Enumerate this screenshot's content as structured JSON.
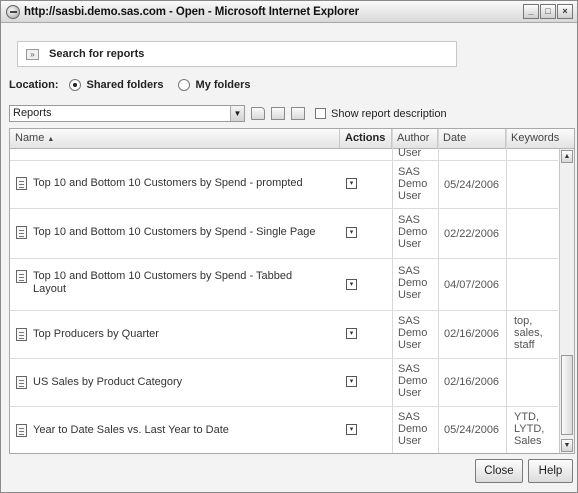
{
  "window": {
    "title": "http://sasbi.demo.sas.com - Open - Microsoft Internet Explorer",
    "controls": [
      "_",
      "□",
      "×"
    ]
  },
  "search": {
    "label": "Search for reports"
  },
  "location": {
    "label": "Location:",
    "options": [
      {
        "label": "Shared folders",
        "selected": true
      },
      {
        "label": "My folders",
        "selected": false
      }
    ]
  },
  "toolbar": {
    "folder_value": "Reports",
    "show_description_label": "Show report description",
    "show_description_checked": false
  },
  "grid": {
    "columns": [
      "Name",
      "Actions",
      "Author",
      "Date",
      "Keywords"
    ],
    "sort_indicator": "▲",
    "partial_top_author": "User",
    "rows": [
      {
        "name": "Top 10 and Bottom 10 Customers by Spend - prompted",
        "author": [
          "SAS",
          "Demo",
          "User"
        ],
        "date": "05/24/2006",
        "keywords": []
      },
      {
        "name": "Top 10 and Bottom 10 Customers by Spend - Single Page",
        "author": [
          "SAS",
          "Demo",
          "User"
        ],
        "date": "02/22/2006",
        "keywords": []
      },
      {
        "name": "Top 10 and Bottom 10 Customers by Spend - Tabbed Layout",
        "author": [
          "SAS",
          "Demo",
          "User"
        ],
        "date": "04/07/2006",
        "keywords": []
      },
      {
        "name": "Top Producers by Quarter",
        "author": [
          "SAS",
          "Demo",
          "User"
        ],
        "date": "02/16/2006",
        "keywords": [
          "top,",
          "sales,",
          "staff"
        ]
      },
      {
        "name": "US Sales by Product Category",
        "author": [
          "SAS",
          "Demo",
          "User"
        ],
        "date": "02/16/2006",
        "keywords": []
      },
      {
        "name": "Year to Date Sales vs. Last Year to Date",
        "author": [
          "SAS",
          "Demo",
          "User"
        ],
        "date": "05/24/2006",
        "keywords": [
          "YTD,",
          "LYTD,",
          "Sales"
        ]
      }
    ]
  },
  "buttons": {
    "close": "Close",
    "help": "Help"
  }
}
